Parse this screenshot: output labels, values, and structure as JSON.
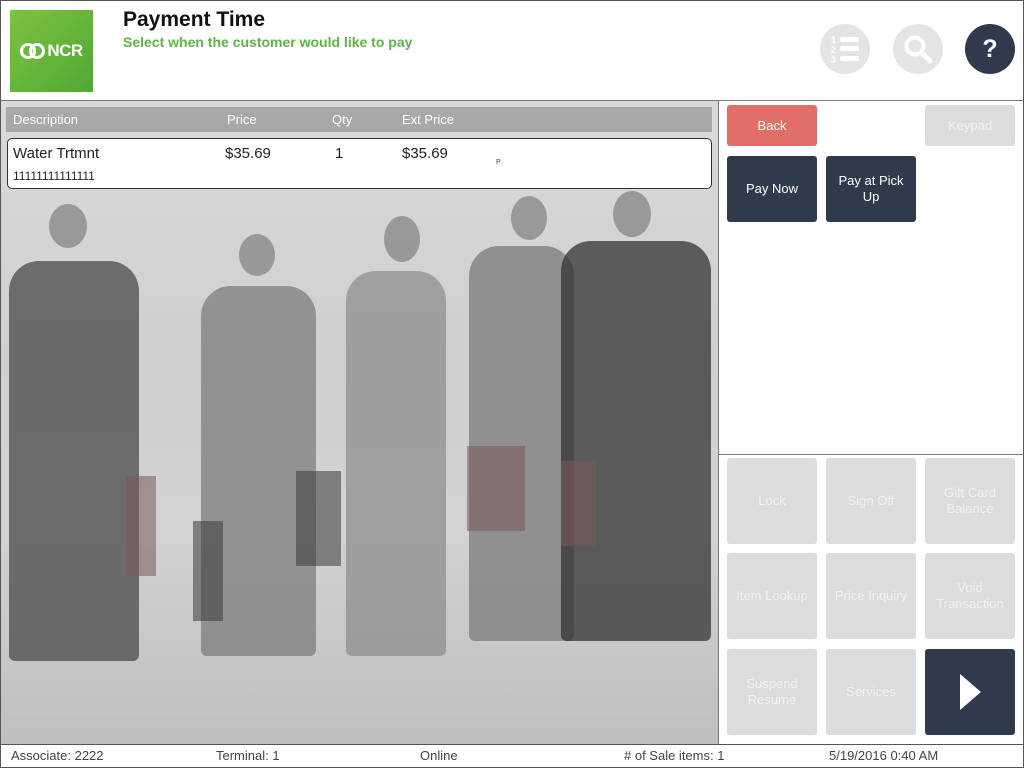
{
  "header": {
    "logo_text": "NCR",
    "title": "Payment Time",
    "subtitle": "Select when the customer would like to pay",
    "help_label": "?",
    "icons": [
      "numbered-list-icon",
      "search-icon",
      "help-icon"
    ]
  },
  "table": {
    "headers": [
      "Description",
      "Price",
      "Qty",
      "Ext Price"
    ],
    "rows": [
      {
        "description": "Water Trtmnt",
        "price": "$35.69",
        "qty": "1",
        "ext_price": "$35.69",
        "code": "11111111111111",
        "flag": "P"
      }
    ]
  },
  "actions": {
    "back": "Back",
    "keypad": "Keypad",
    "pay_now": "Pay Now",
    "pay_at_pickup": "Pay at Pick Up"
  },
  "function_buttons": {
    "lock": "Lock",
    "sign_off": "Sign Off",
    "gift_card_balance": "Gift Card Balance",
    "item_lookup": "Item Lookup",
    "price_inquiry": "Price Inquiry",
    "void_transaction": "Void Transaction",
    "suspend_resume": "Suspend Resume",
    "services": "Services"
  },
  "status_bar": {
    "associate": "Associate: 2222",
    "terminal": "Terminal: 1",
    "connection": "Online",
    "sale_items": "# of Sale items: 1",
    "datetime": "5/19/2016 0:40 AM"
  },
  "colors": {
    "brand_green": "#5cb445",
    "dark_button": "#2f3b4c",
    "back_button": "#e26e68",
    "disabled_button": "#dcdcdc"
  }
}
